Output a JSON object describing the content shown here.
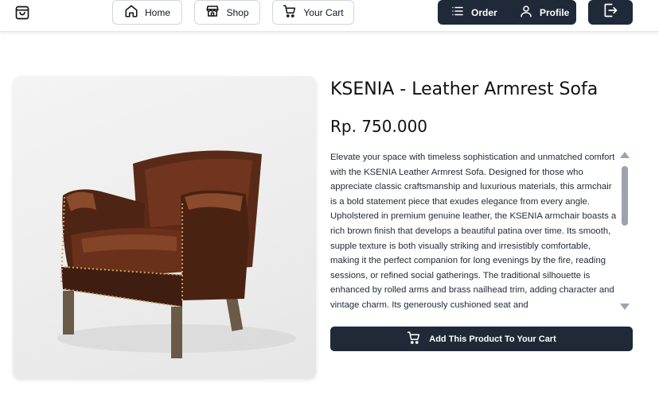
{
  "nav": {
    "logo_icon": "shopping-bag-icon",
    "home_label": "Home",
    "shop_label": "Shop",
    "cart_label": "Your Cart",
    "order_label": "Order",
    "profile_label": "Profile",
    "logout_icon": "logout-icon"
  },
  "product": {
    "title": "KSENIA - Leather Armrest Sofa",
    "price": "Rp. 750.000",
    "description": "Elevate your space with timeless sophistication and unmatched comfort with the KSENIA Leather Armrest Sofa. Designed for those who appreciate classic craftsmanship and luxurious materials, this armchair is a bold statement piece that exudes elegance from every angle. Upholstered in premium genuine leather, the KSENIA armchair boasts a rich brown finish that develops a beautiful patina over time. Its smooth, supple texture is both visually striking and irresistibly comfortable, making it the perfect companion for long evenings by the fire, reading sessions, or refined social gatherings. The traditional silhouette is enhanced by rolled arms and brass nailhead trim, adding character and vintage charm. Its generously cushioned seat and",
    "add_to_cart_label": "Add This Product To Your Cart"
  },
  "colors": {
    "primary_dark": "#1f2937",
    "leather_brown": "#5a2a18",
    "page_bg": "#ffffff"
  }
}
